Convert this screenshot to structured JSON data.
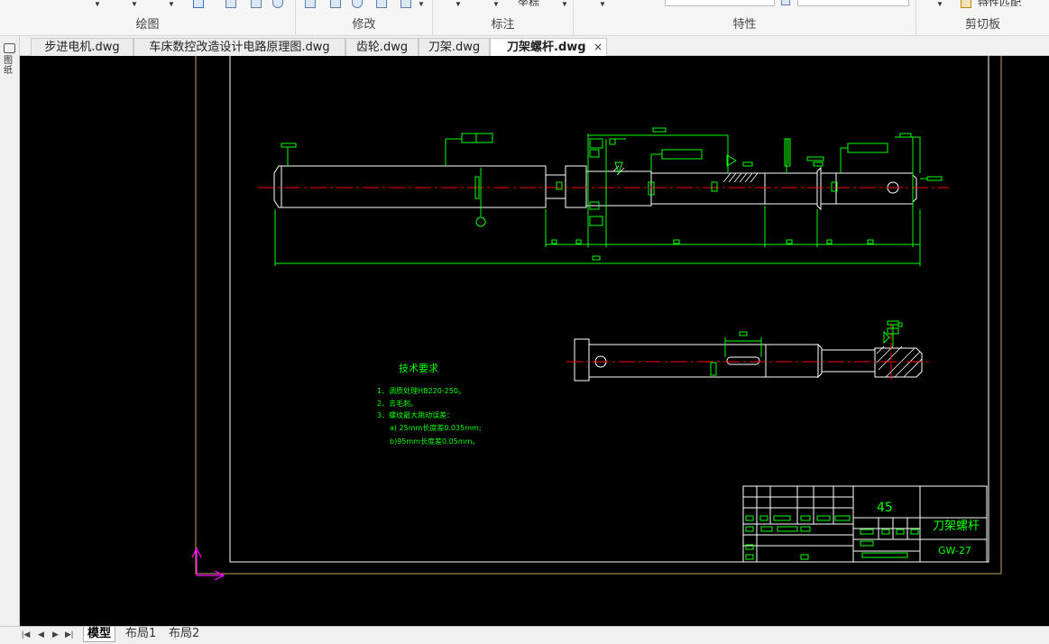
{
  "ribbon": {
    "groups": [
      {
        "label": "绘图"
      },
      {
        "label": "修改"
      },
      {
        "label": "标注"
      },
      {
        "label": "特性"
      },
      {
        "label": "剪切板"
      }
    ],
    "partial_buttons": {
      "zuobiao": "坐标",
      "match": "特性匹配"
    }
  },
  "tabs": [
    {
      "label": "步进电机.dwg"
    },
    {
      "label": "车床数控改造设计电路原理图.dwg"
    },
    {
      "label": "齿轮.dwg"
    },
    {
      "label": "刀架.dwg"
    },
    {
      "label": "刀架螺杆.dwg",
      "active": true
    }
  ],
  "tab_close": "×",
  "left_strip_label": "图纸",
  "drawing": {
    "tech_title": "技术要求",
    "tech_lines": [
      "1、调质处理HB220-250。",
      "2、去毛刺。",
      "3、螺纹最大跳动误差：",
      "a) 25mm长度差0.035mm;",
      "b)95mm长度差0.05mm。"
    ],
    "material": "45",
    "part_name": "刀架螺杆",
    "drawing_no": "GW-27"
  },
  "layout_tabs": [
    {
      "label": "模型",
      "active": true
    },
    {
      "label": "布局1"
    },
    {
      "label": "布局2"
    }
  ],
  "colors": {
    "canvas": "#000000",
    "outline": "#ffffff",
    "dimension": "#00ff00",
    "centerline": "#ff0000",
    "ucs": "#ff00ff",
    "frame": "#c8a46e"
  }
}
